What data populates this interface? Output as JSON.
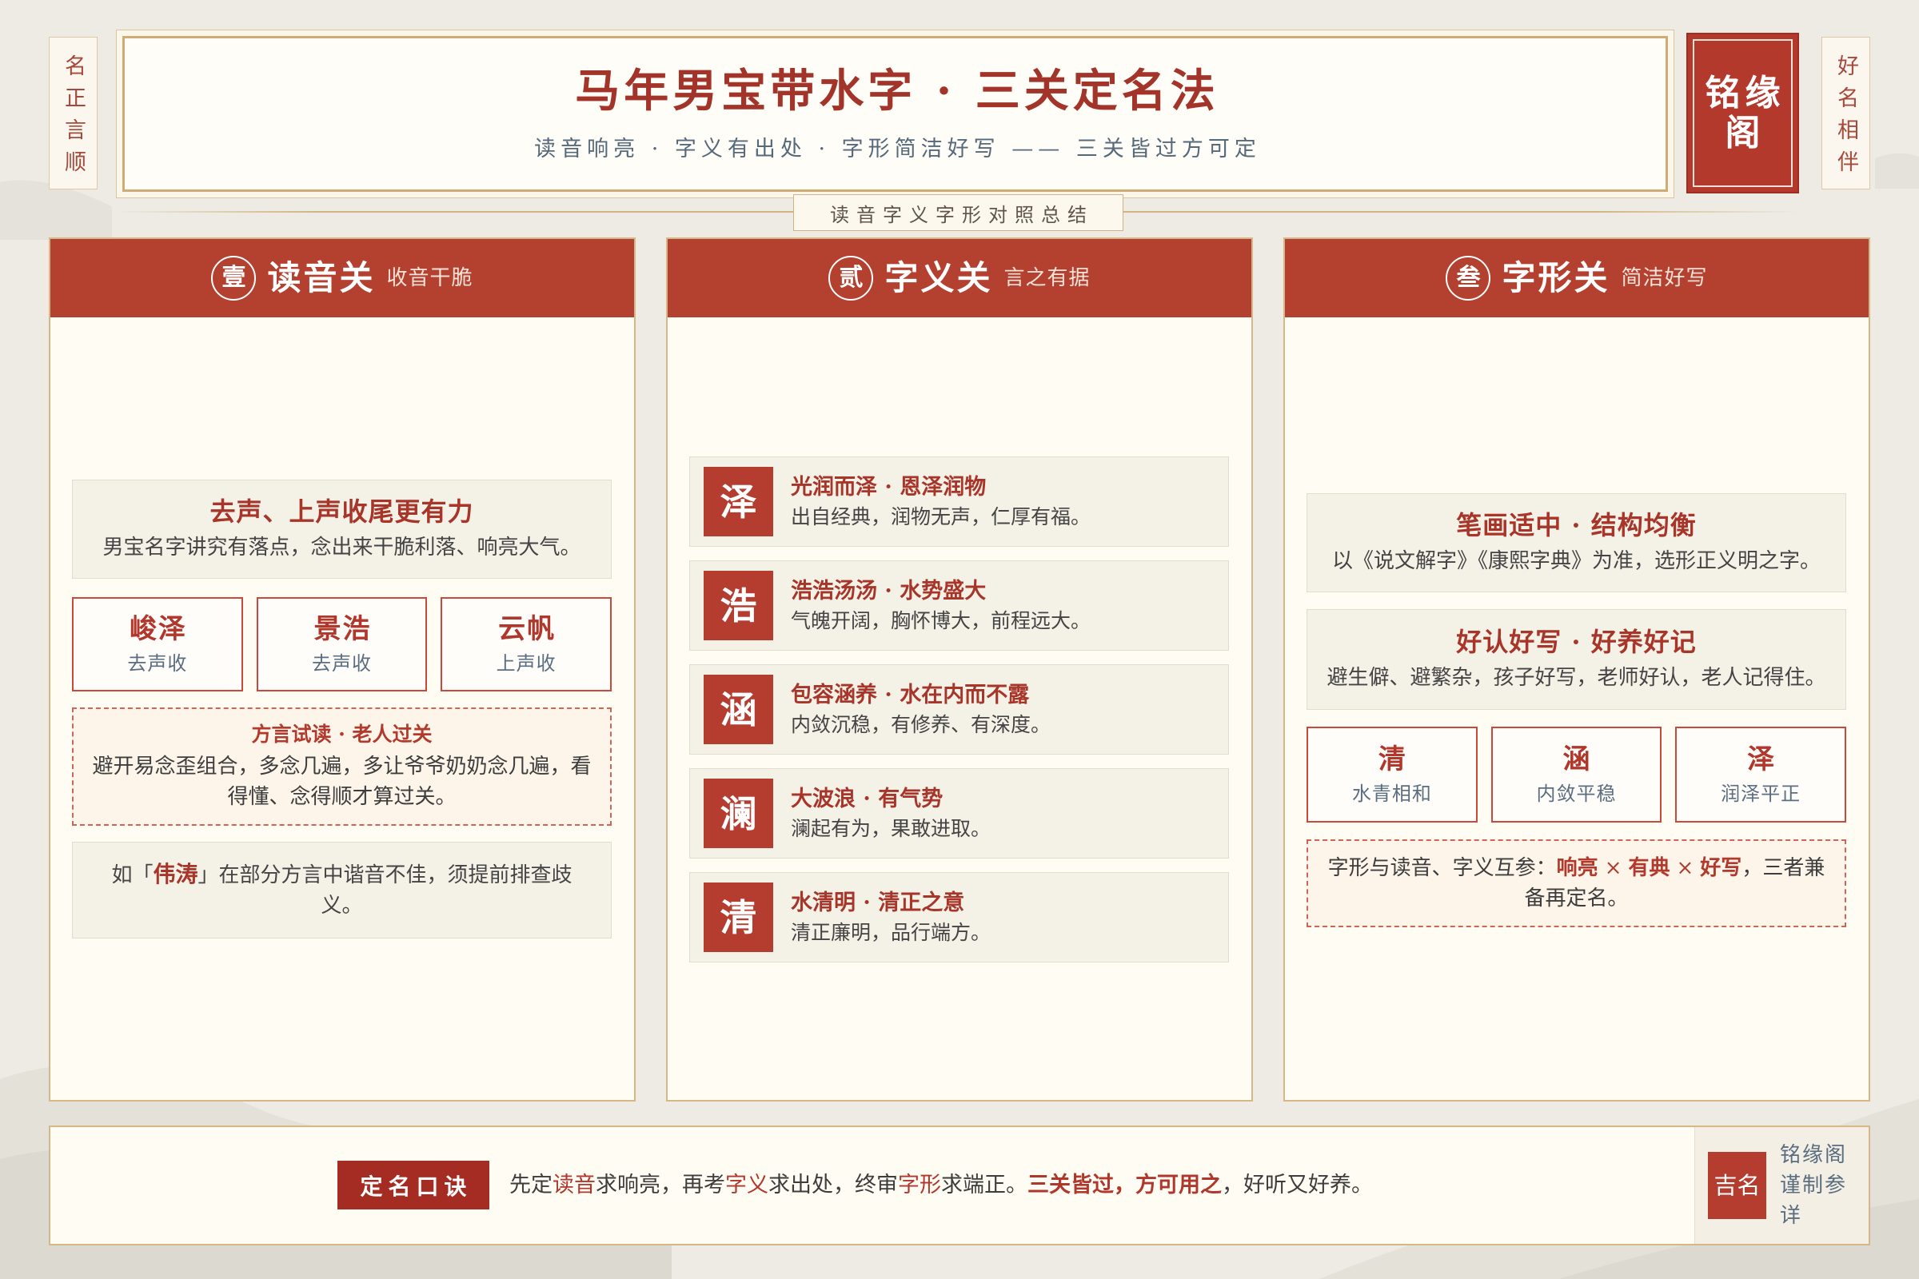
{
  "theme": {
    "red": "#b4412f",
    "deep_red": "#a52c22",
    "text_red": "#a8352a",
    "slate": "#56697b",
    "gold": "#d6b785",
    "page_bg": "#edebe4"
  },
  "side_banners": {
    "left": "名正言顺",
    "right": "好名相伴"
  },
  "header": {
    "title": "马年男宝带水字 · 三关定名法",
    "subtitle": "读音响亮 · 字义有出处 · 字形简洁好写 —— 三关皆过方可定",
    "seal": {
      "line1": "铭缘",
      "line2": "阁"
    }
  },
  "divider_label": "读音字义字形对照总结",
  "columns": [
    {
      "numeral": "壹",
      "title": "读音关",
      "subtitle": "收音干脆",
      "rule": {
        "title": "去声、上声收尾更有力",
        "text": "男宝名字讲究有落点，念出来干脆利落、响亮大气。"
      },
      "names": [
        {
          "name": "峻泽",
          "tone": "去声收"
        },
        {
          "name": "景浩",
          "tone": "去声收"
        },
        {
          "name": "云帆",
          "tone": "上声收"
        }
      ],
      "tip": {
        "title": "方言试读 · 老人过关",
        "text": "避开易念歪组合，多念几遍，多让爷爷奶奶念几遍，看得懂、念得顺才算过关。"
      },
      "warning": {
        "prefix": "如「",
        "highlight": "伟涛",
        "suffix": "」在部分方言中谐音不佳，须提前排查歧义。"
      }
    },
    {
      "numeral": "贰",
      "title": "字义关",
      "subtitle": "言之有据",
      "chars": [
        {
          "char": "泽",
          "title": "光润而泽 · 恩泽润物",
          "text": "出自经典，润物无声，仁厚有福。"
        },
        {
          "char": "浩",
          "title": "浩浩汤汤 · 水势盛大",
          "text": "气魄开阔，胸怀博大，前程远大。"
        },
        {
          "char": "涵",
          "title": "包容涵养 · 水在内而不露",
          "text": "内敛沉稳，有修养、有深度。"
        },
        {
          "char": "澜",
          "title": "大波浪 · 有气势",
          "text": "澜起有为，果敢进取。"
        },
        {
          "char": "清",
          "title": "水清明 · 清正之意",
          "text": "清正廉明，品行端方。"
        }
      ]
    },
    {
      "numeral": "叁",
      "title": "字形关",
      "subtitle": "简洁好写",
      "rules": [
        {
          "title": "笔画适中 · 结构均衡",
          "text": "以《说文解字》《康熙字典》为准，选形正义明之字。"
        },
        {
          "title": "好认好写 · 好养好记",
          "text": "避生僻、避繁杂，孩子好写，老师好认，老人记得住。"
        }
      ],
      "chars": [
        {
          "char": "清",
          "meaning": "水青相和"
        },
        {
          "char": "涵",
          "meaning": "内敛平稳"
        },
        {
          "char": "泽",
          "meaning": "润泽平正"
        }
      ],
      "note": {
        "prefix": "字形与读音、字义互参：",
        "keys": [
          "响亮",
          "有典",
          "好写"
        ],
        "times": "×",
        "suffix": "，三者兼备再定名。"
      }
    }
  ],
  "footer": {
    "label": "定名口诀",
    "verse": {
      "s1": "先定",
      "k1": "读音",
      "s2": "求响亮，再考",
      "k2": "字义",
      "s3": "求出处，终审",
      "k3": "字形",
      "s4": "求端正。",
      "k4": "三关皆过，方可用之",
      "s5": "，好听又好养。"
    },
    "seal": "吉名",
    "maker": "铭缘阁谨制参详"
  }
}
